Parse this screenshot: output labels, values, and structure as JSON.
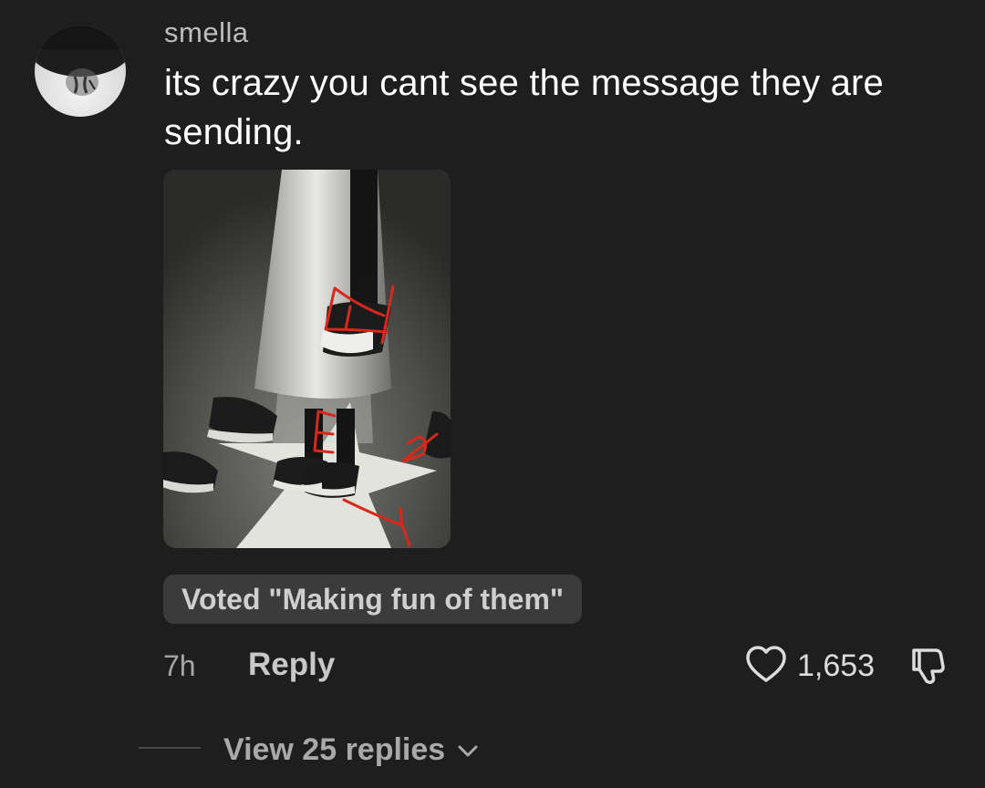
{
  "comment": {
    "username": "smella",
    "text": "its crazy you cant see the message they are sending.",
    "vote_badge": "Voted \"Making fun of them\"",
    "time": "7h",
    "reply_label": "Reply",
    "like_count": "1,653",
    "view_replies_label": "View 25 replies"
  },
  "icons": {
    "like": "heart-outline-icon",
    "dislike": "thumbs-down-outline-icon",
    "expand": "chevron-down-icon"
  },
  "colors": {
    "background": "#1e1e1e",
    "badge_background": "#3b3b3b",
    "annotation_red": "#d8281c"
  }
}
